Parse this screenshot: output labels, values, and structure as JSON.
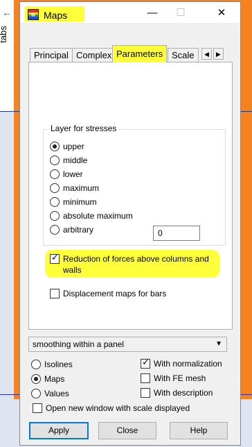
{
  "background": {
    "side_tab_label": "tabs",
    "side_tab_arrow": "←"
  },
  "window": {
    "title": "Maps",
    "app_icon": "maps-app-icon",
    "minimize": "—",
    "maximize": "☐",
    "close": "✕"
  },
  "tabs": [
    {
      "label": "Principal"
    },
    {
      "label": "Complex"
    },
    {
      "label": "Parameters"
    },
    {
      "label": "Scale"
    }
  ],
  "tab_scroll": {
    "left": "◀",
    "right": "▶"
  },
  "stresses_group": {
    "title": "Layer for stresses",
    "options": [
      {
        "label": "upper",
        "checked": true
      },
      {
        "label": "middle",
        "checked": false
      },
      {
        "label": "lower",
        "checked": false
      },
      {
        "label": "maximum",
        "checked": false
      },
      {
        "label": "minimum",
        "checked": false
      },
      {
        "label": "absolute maximum",
        "checked": false
      },
      {
        "label": "arbitrary",
        "checked": false
      }
    ],
    "arbitrary_value": "0"
  },
  "reduction_checkbox": {
    "label": "Reduction of forces above columns and walls",
    "checked": true
  },
  "displacement_checkbox": {
    "label": "Displacement maps for bars",
    "checked": false
  },
  "smoothing_select": {
    "value": "smoothing within a panel"
  },
  "display_mode": [
    {
      "label": "Isolines",
      "checked": false
    },
    {
      "label": "Maps",
      "checked": true
    },
    {
      "label": "Values",
      "checked": false
    }
  ],
  "options_right": [
    {
      "label": "With normalization",
      "checked": true
    },
    {
      "label": "With FE mesh",
      "checked": false
    },
    {
      "label": "With description",
      "checked": false
    }
  ],
  "open_window_checkbox": {
    "label": "Open new window with scale displayed",
    "checked": false
  },
  "buttons": {
    "apply": "Apply",
    "close": "Close",
    "help": "Help"
  },
  "colors": {
    "highlight": "#ffff3a",
    "background_app": "#f58220",
    "accent": "#0078d7"
  }
}
